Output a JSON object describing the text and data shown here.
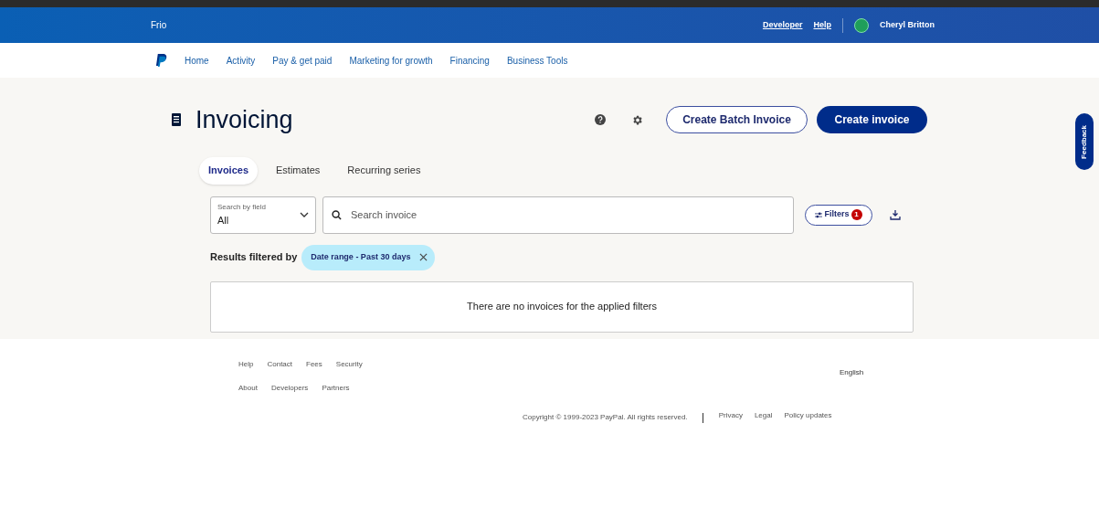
{
  "header": {
    "account": "Frio",
    "links": [
      "Developer",
      "Help"
    ],
    "user": "Cheryl Britton"
  },
  "nav": [
    "Home",
    "Activity",
    "Pay & get paid",
    "Marketing for growth",
    "Financing",
    "Business Tools"
  ],
  "page": {
    "title": "Invoicing",
    "secondary_button": "Create Batch Invoice",
    "primary_button": "Create invoice"
  },
  "tabs": [
    {
      "label": "Invoices",
      "selected": true
    },
    {
      "label": "Estimates",
      "selected": false
    },
    {
      "label": "Recurring series",
      "selected": false
    }
  ],
  "search_by": {
    "label": "Search by field",
    "value": "All"
  },
  "search": {
    "placeholder": "Search invoice"
  },
  "filters": {
    "label": "Filters",
    "count": "1"
  },
  "filtered_by": {
    "label": "Results filtered by",
    "chips": [
      "Date range - Past 30 days"
    ]
  },
  "empty_message": "There are no invoices for the applied filters",
  "feedback": "Feedback",
  "footer": {
    "links_row1": [
      "Help",
      "Contact",
      "Fees",
      "Security"
    ],
    "links_row2": [
      "About",
      "Developers",
      "Partners"
    ],
    "language": "English",
    "copyright": "Copyright © 1999-2023 PayPal. All rights reserved.",
    "legal_links": [
      "Privacy",
      "Legal",
      "Policy updates"
    ]
  }
}
